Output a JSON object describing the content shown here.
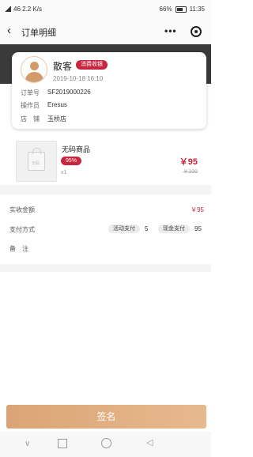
{
  "status_bar": {
    "left_text": "46 2.2 K/s",
    "battery_pct": "66%",
    "time": "11:35"
  },
  "header": {
    "title": "订单明细",
    "more_icon": "more-dots",
    "target_icon": "target-icon"
  },
  "customer": {
    "name": "散客",
    "badge": "消费收银",
    "datetime": "2019-10-18 16:10",
    "fields": [
      {
        "label": "订单号",
        "value": "SF2019000226"
      },
      {
        "label": "操作员",
        "value": "Eresus"
      },
      {
        "label": "店　铺",
        "value": "玉桥店"
      }
    ]
  },
  "product": {
    "image_text": "无码",
    "name": "无码商品",
    "discount": "95%",
    "qty": "x1",
    "price": "￥95",
    "original_price": "￥100"
  },
  "summary": {
    "paid_label": "实收金额",
    "paid_value": "￥95",
    "method_label": "支付方式",
    "methods": [
      {
        "name": "活动支付",
        "amount": "5"
      },
      {
        "name": "现金支付",
        "amount": "95"
      }
    ],
    "remark_label": "备　注"
  },
  "sign_button": "签名",
  "colors": {
    "accent": "#c8253e",
    "button": "#dba475",
    "band": "#3a3a3a"
  }
}
